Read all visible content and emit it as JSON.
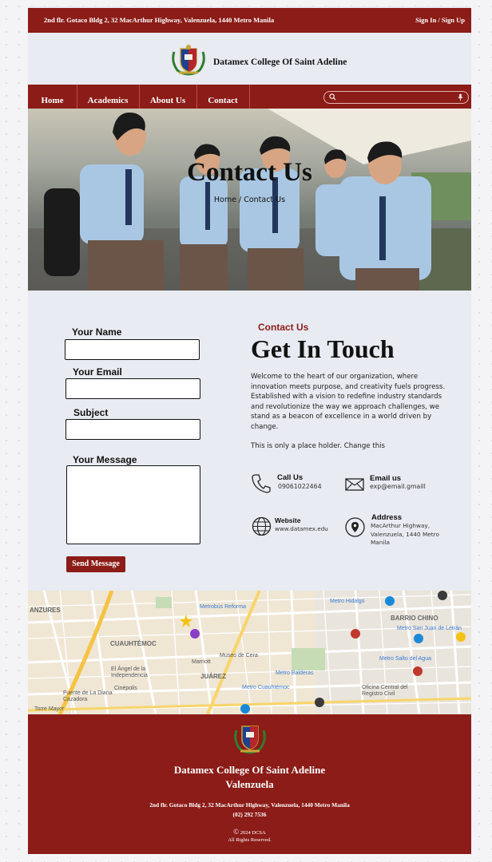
{
  "topbar": {
    "address": "2nd flr. Gotaco Bldg 2, 32 MacArthur Highway, Valenzuela, 1440 Metro Manila",
    "auth_link": "Sign In / Sign Up"
  },
  "brand": {
    "name": "Datamex College Of Saint Adeline"
  },
  "nav": {
    "items": [
      {
        "label": "Home"
      },
      {
        "label": "Academics"
      },
      {
        "label": "About Us"
      },
      {
        "label": "Contact"
      }
    ],
    "search": {
      "placeholder": ""
    }
  },
  "hero": {
    "title": "Contact Us",
    "breadcrumb": "Home / Contact Us"
  },
  "form": {
    "name_label": "Your Name",
    "email_label": "Your Email",
    "subject_label": "Subject",
    "message_label": "Your Message",
    "submit_label": "Send Message"
  },
  "info": {
    "kicker": "Contact Us",
    "heading": "Get In Touch",
    "paragraph": "Welcome to the heart of our organization, where innovation meets purpose, and creativity fuels progress. Established with a vision to redefine industry standards and revolutionize the way we approach challenges, we stand as a beacon of excellence in a world driven by change.",
    "note": "This is only a place holder. Change this",
    "call": {
      "title": "Call Us",
      "value": "09061022464"
    },
    "email": {
      "title": "Email us",
      "value": "exp@email.gmaill"
    },
    "website": {
      "title": "Website",
      "value": "www.datamex.edu"
    },
    "address": {
      "title": "Address",
      "value": "MacArthur Highway, Valenzuela, 1440 Metro Manila"
    }
  },
  "map": {
    "labels": {
      "anzures": "ANZURES",
      "cuauhtemoc": "CUAUHTÉMOC",
      "barrio_chino": "BARRIO CHINO",
      "juarez": "JUÁREZ",
      "angel": "El Ángel de la Independencia",
      "cinepolis": "Cinépolis",
      "marriott": "Marriott",
      "museo": "Museo de Cera",
      "fuente": "Fuente de La Diana Cazadora",
      "torre": "Torre Mayor",
      "oficina": "Oficina Central del Registro Civil",
      "metro_reforma": "Metrobús Reforma",
      "metro_hidalgo": "Metro Hidalgo",
      "metro_cuauhtemoc": "Metro Cuauhtémoc",
      "metro_salto": "Metro Salto del Agua",
      "metro_sanjuan": "Metro San Juan de Letrán",
      "metro_balderas": "Metro Balderas"
    }
  },
  "footer": {
    "name_line1": "Datamex College Of Saint Adeline",
    "name_line2": "Valenzuela",
    "address": "2nd flr. Gotaco Bldg 2, 32 MacArthur Highway, Valenzuela, 1440 Metro Manila",
    "phone": "(02) 292 7536",
    "copyright": "2024 DCSA",
    "rights": "All Rights Reserved."
  },
  "colors": {
    "brand_red": "#8b1c17",
    "page_bg": "#e8ebf1"
  }
}
